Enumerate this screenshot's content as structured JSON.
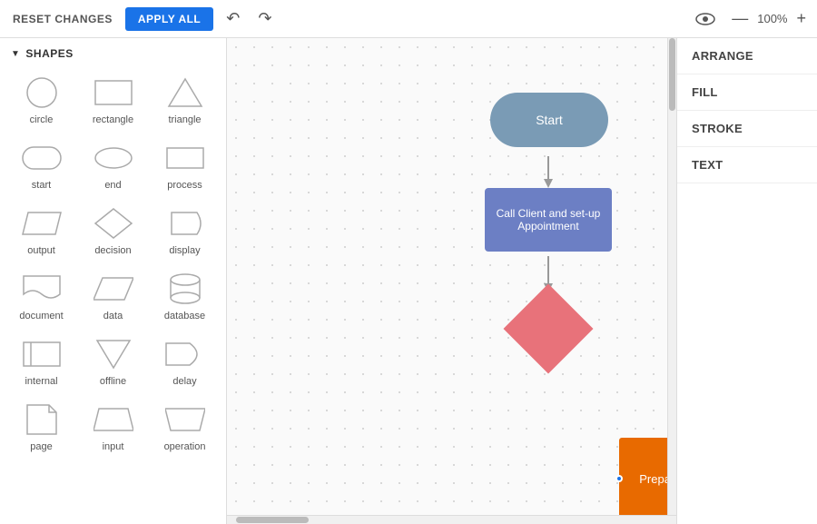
{
  "toolbar": {
    "reset_label": "RESET CHANGES",
    "apply_label": "APPLY ALL",
    "zoom": "100%",
    "zoom_in": "+",
    "zoom_out": "—"
  },
  "shapes_panel": {
    "header": "SHAPES",
    "items": [
      {
        "id": "circle",
        "label": "circle",
        "shape": "circle"
      },
      {
        "id": "rectangle",
        "label": "rectangle",
        "shape": "rectangle"
      },
      {
        "id": "triangle",
        "label": "triangle",
        "shape": "triangle"
      },
      {
        "id": "start",
        "label": "start",
        "shape": "start"
      },
      {
        "id": "end",
        "label": "end",
        "shape": "end"
      },
      {
        "id": "process",
        "label": "process",
        "shape": "process"
      },
      {
        "id": "output",
        "label": "output",
        "shape": "output"
      },
      {
        "id": "decision",
        "label": "decision",
        "shape": "decision"
      },
      {
        "id": "display",
        "label": "display",
        "shape": "display"
      },
      {
        "id": "document",
        "label": "document",
        "shape": "document"
      },
      {
        "id": "data",
        "label": "data",
        "shape": "data"
      },
      {
        "id": "database",
        "label": "database",
        "shape": "database"
      },
      {
        "id": "internal",
        "label": "internal",
        "shape": "internal"
      },
      {
        "id": "offline",
        "label": "offline",
        "shape": "offline"
      },
      {
        "id": "delay",
        "label": "delay",
        "shape": "delay"
      },
      {
        "id": "page",
        "label": "page",
        "shape": "page"
      },
      {
        "id": "input",
        "label": "input",
        "shape": "input"
      },
      {
        "id": "operation",
        "label": "operation",
        "shape": "operation"
      }
    ]
  },
  "flowchart": {
    "start_label": "Start",
    "process_label": "Call Client and set-up Appointment",
    "selected_label": "Prepare a Laptop"
  },
  "right_panel": {
    "arrange": "ARRANGE",
    "fill": "FILL",
    "stroke": "STROKE",
    "text": "TEXT"
  }
}
